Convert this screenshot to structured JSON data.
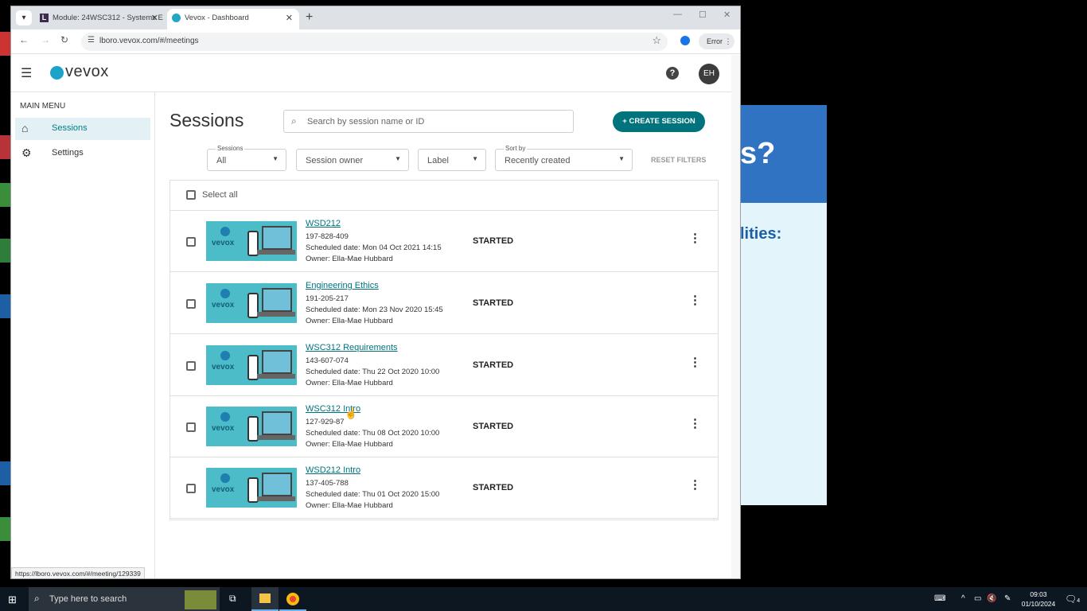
{
  "browser": {
    "tabs": [
      {
        "title": "Module: 24WSC312 - Systems E",
        "favicon": "L"
      },
      {
        "title": "Vevox - Dashboard"
      }
    ],
    "new_tab": "+",
    "url": "lboro.vevox.com/#/meetings",
    "error_label": "Error",
    "status_url": "https://lboro.vevox.com/#/meeting/129339"
  },
  "app": {
    "brand": "vevox",
    "avatar_initials": "EH",
    "help_symbol": "?"
  },
  "sidebar": {
    "heading": "MAIN MENU",
    "items": [
      {
        "label": "Sessions",
        "icon": "home-icon",
        "active": true
      },
      {
        "label": "Settings",
        "icon": "gear-icon",
        "active": false
      }
    ]
  },
  "main": {
    "title": "Sessions",
    "search_placeholder": "Search by session name or ID",
    "create_button": "+ CREATE SESSION",
    "filters": {
      "sessions": {
        "label": "Sessions",
        "value": "All"
      },
      "owner": {
        "value": "Session owner"
      },
      "label": {
        "value": "Label"
      },
      "sort": {
        "label": "Sort by",
        "value": "Recently created"
      }
    },
    "reset_filters": "RESET FILTERS",
    "select_all": "Select all",
    "thumbnail_text": "vevox",
    "sessions": [
      {
        "name": "WSD212",
        "id": "197-828-409",
        "scheduled": "Scheduled date: Mon 04 Oct 2021 14:15",
        "owner": "Owner: Ella-Mae Hubbard",
        "status": "STARTED"
      },
      {
        "name": "Engineering Ethics",
        "id": "191-205-217",
        "scheduled": "Scheduled date: Mon 23 Nov 2020 15:45",
        "owner": "Owner: Ella-Mae Hubbard",
        "status": "STARTED"
      },
      {
        "name": "WSC312 Requirements",
        "id": "143-607-074",
        "scheduled": "Scheduled date: Thu 22 Oct 2020 10:00",
        "owner": "Owner: Ella-Mae Hubbard",
        "status": "STARTED"
      },
      {
        "name": "WSC312 Intro",
        "id": "127-929-87",
        "scheduled": "Scheduled date: Thu 08 Oct 2020 10:00",
        "owner": "Owner: Ella-Mae Hubbard",
        "status": "STARTED"
      },
      {
        "name": "WSD212 Intro",
        "id": "137-405-788",
        "scheduled": "Scheduled date: Thu 01 Oct 2020 15:00",
        "owner": "Owner: Ella-Mae Hubbard",
        "status": "STARTED"
      }
    ]
  },
  "background_window": {
    "heading": "s?",
    "subheading": "lities:"
  },
  "taskbar": {
    "search_placeholder": "Type here to search",
    "time": "09:03",
    "date": "01/10/2024",
    "notification_count": "4"
  },
  "colors": {
    "accent": "#00737c",
    "active_bg": "#e3f1f4",
    "brand_blue": "#2f73c2"
  }
}
